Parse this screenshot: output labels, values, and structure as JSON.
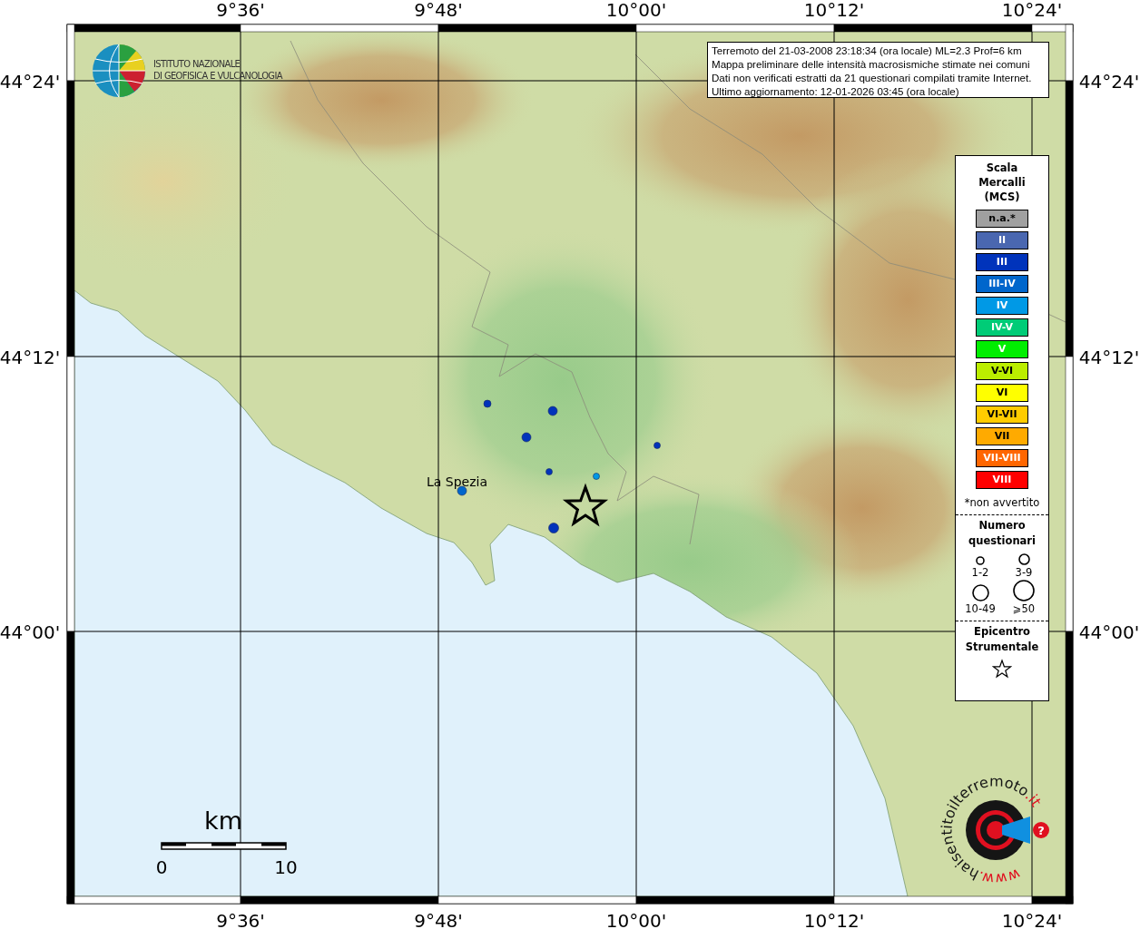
{
  "map": {
    "top_ticks": [
      "9°36'",
      "9°48'",
      "10°00'",
      "10°12'",
      "10°24'"
    ],
    "bottom_ticks": [
      "9°36'",
      "9°48'",
      "10°00'",
      "10°12'",
      "10°24'"
    ],
    "left_ticks": [
      "44°24'",
      "44°12'",
      "44°00'"
    ],
    "right_ticks": [
      "44°24'",
      "44°12'",
      "44°00'"
    ],
    "info_box": {
      "lines": [
        "Terremoto del 21-03-2008 23:18:34 (ora locale) ML=2.3 Prof=6 km",
        "Mappa preliminare delle intensità macrosismiche stimate nei comuni",
        "Dati non verificati estratti da 21 questionari compilati tramite Internet.",
        "Ultimo aggiornamento: 12-01-2026 03:45 (ora locale)"
      ]
    },
    "institute_logo": {
      "lines": [
        "ISTITUTO NAZIONALE",
        "DI GEOFISICA E VULCANOLOGIA"
      ]
    },
    "places": [
      {
        "name": "La Spezia"
      }
    ],
    "reports": [
      {
        "color": "#0033bb"
      },
      {
        "color": "#0033bb"
      },
      {
        "color": "#0033bb"
      },
      {
        "color": "#0033bb"
      },
      {
        "color": "#0099e6"
      },
      {
        "color": "#0033bb"
      },
      {
        "color": "#0066cc"
      },
      {
        "color": "#0033bb"
      }
    ],
    "scale_bar": {
      "unit": "km",
      "labels": [
        "0",
        "10"
      ]
    },
    "site_logo": {
      "prefix": "www.",
      "name": "haisentitoilterremoto",
      "suffix": ".it",
      "badge": "?"
    }
  },
  "legend": {
    "title": "Scala Mercalli (MCS)",
    "levels": [
      {
        "label": "n.a.*",
        "color": "#a0a0a0"
      },
      {
        "label": "II",
        "color": "#4a67b0"
      },
      {
        "label": "III",
        "color": "#0033bb"
      },
      {
        "label": "III-IV",
        "color": "#0066cc"
      },
      {
        "label": "IV",
        "color": "#0099e6"
      },
      {
        "label": "IV-V",
        "color": "#00cc77"
      },
      {
        "label": "V",
        "color": "#00ee00"
      },
      {
        "label": "V-VI",
        "color": "#bbee00"
      },
      {
        "label": "VI",
        "color": "#ffff00"
      },
      {
        "label": "VI-VII",
        "color": "#ffcc00"
      },
      {
        "label": "VII",
        "color": "#ffaa00"
      },
      {
        "label": "VII-VIII",
        "color": "#ff6600"
      },
      {
        "label": "VIII",
        "color": "#ff0000"
      }
    ],
    "footnote": "*non avvertito",
    "count_title": "Numero questionari",
    "count_sizes": [
      {
        "label": "1-2"
      },
      {
        "label": "3-9"
      },
      {
        "label": "10-49"
      },
      {
        "label": "⩾50"
      }
    ],
    "epicentre_title": "Epicentro Strumentale"
  }
}
